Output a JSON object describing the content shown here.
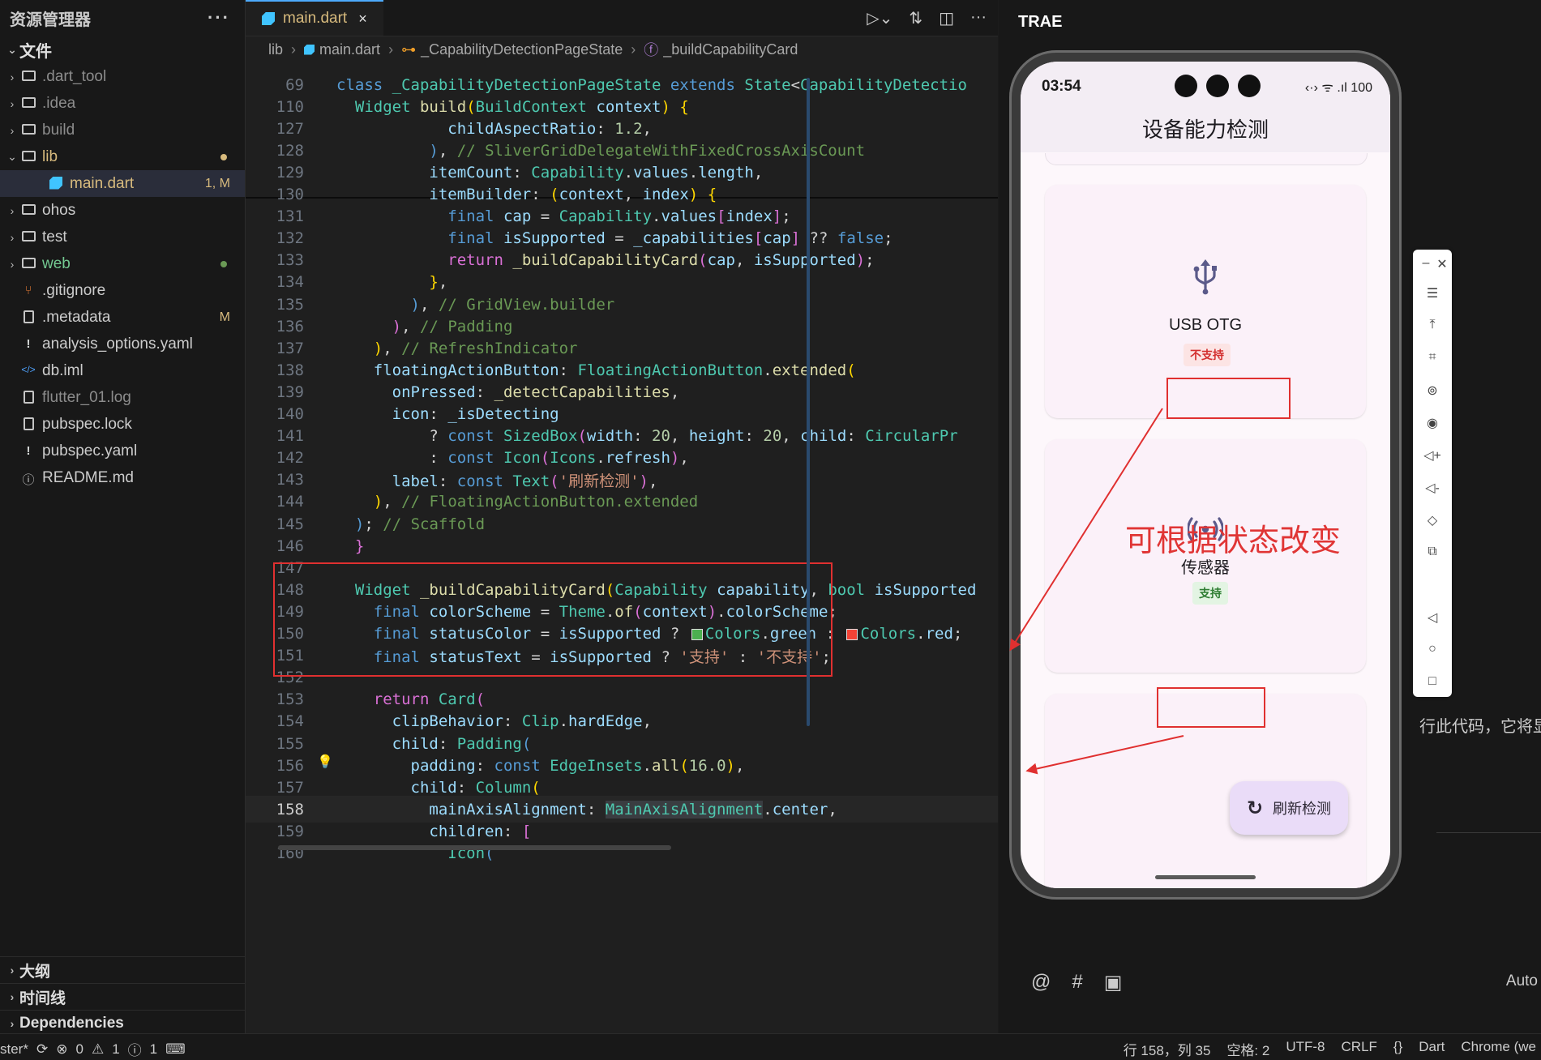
{
  "explorer": {
    "title": "资源管理器",
    "more": "···",
    "section": "文件",
    "items": [
      {
        "name": ".dart_tool",
        "kind": "folder"
      },
      {
        "name": ".idea",
        "kind": "folder"
      },
      {
        "name": "build",
        "kind": "folder"
      },
      {
        "name": "lib",
        "kind": "folder-open",
        "dot": "#d7ba7d"
      },
      {
        "name": "main.dart",
        "kind": "dart",
        "badge": "1, M",
        "selected": true
      },
      {
        "name": "ohos",
        "kind": "folder"
      },
      {
        "name": "test",
        "kind": "folder"
      },
      {
        "name": "web",
        "kind": "folder",
        "dot": "#6a9955"
      },
      {
        "name": ".gitignore",
        "kind": "git"
      },
      {
        "name": ".metadata",
        "kind": "file",
        "badge": "M"
      },
      {
        "name": "analysis_options.yaml",
        "kind": "yaml"
      },
      {
        "name": "db.iml",
        "kind": "code"
      },
      {
        "name": "flutter_01.log",
        "kind": "file"
      },
      {
        "name": "pubspec.lock",
        "kind": "file"
      },
      {
        "name": "pubspec.yaml",
        "kind": "yaml"
      },
      {
        "name": "README.md",
        "kind": "info"
      }
    ],
    "bottom": [
      "大纲",
      "时间线",
      "Dependencies"
    ]
  },
  "editor": {
    "tab": {
      "label": "main.dart",
      "close": "×"
    },
    "breadcrumb": [
      "lib",
      "main.dart",
      "_CapabilityDetectionPageState",
      "_buildCapabilityCard"
    ],
    "lines": [
      {
        "n": "69",
        "html": "<span class='k'>class</span> <span class='t'>_CapabilityDetectionPageState</span> <span class='k'>extends</span> <span class='t'>State</span><span class='o'>&lt;</span><span class='t'>CapabilityDetectio</span>"
      },
      {
        "n": "110",
        "html": "  <span class='t'>Widget</span> <span class='f'>build</span><span class='y'>(</span><span class='t'>BuildContext</span> <span class='v'>context</span><span class='y'>)</span> <span class='y'>{</span>"
      },
      {
        "n": "127",
        "html": "            <span class='v'>childAspectRatio</span><span class='o'>:</span> <span class='n'>1.2</span><span class='o'>,</span>"
      },
      {
        "n": "128",
        "html": "          <span class='k'>)</span><span class='o'>,</span> <span class='c'>// SliverGridDelegateWithFixedCrossAxisCount</span>"
      },
      {
        "n": "129",
        "html": "          <span class='v'>itemCount</span><span class='o'>:</span> <span class='t'>Capability</span><span class='o'>.</span><span class='v'>values</span><span class='o'>.</span><span class='v'>length</span><span class='o'>,</span>"
      },
      {
        "n": "130",
        "html": "          <span class='v'>itemBuilder</span><span class='o'>:</span> <span class='y'>(</span><span class='v'>context</span><span class='o'>,</span> <span class='v'>index</span><span class='y'>)</span> <span class='y'>{</span>"
      },
      {
        "n": "131",
        "html": "            <span class='k'>final</span> <span class='v'>cap</span> <span class='o'>=</span> <span class='t'>Capability</span><span class='o'>.</span><span class='v'>values</span><span class='m'>[</span><span class='v'>index</span><span class='m'>]</span><span class='o'>;</span>"
      },
      {
        "n": "132",
        "html": "            <span class='k'>final</span> <span class='v'>isSupported</span> <span class='o'>=</span> <span class='v'>_capabilities</span><span class='m'>[</span><span class='v'>cap</span><span class='m'>]</span> <span class='o'>??</span> <span class='k'>false</span><span class='o'>;</span>"
      },
      {
        "n": "133",
        "html": "            <span class='m'>return</span> <span class='f'>_buildCapabilityCard</span><span class='m'>(</span><span class='v'>cap</span><span class='o'>,</span> <span class='v'>isSupported</span><span class='m'>)</span><span class='o'>;</span>"
      },
      {
        "n": "134",
        "html": "          <span class='y'>}</span><span class='o'>,</span>"
      },
      {
        "n": "135",
        "html": "        <span class='k'>)</span><span class='o'>,</span> <span class='c'>// GridView.builder</span>"
      },
      {
        "n": "136",
        "html": "      <span class='m'>)</span><span class='o'>,</span> <span class='c'>// Padding</span>"
      },
      {
        "n": "137",
        "html": "    <span class='y'>)</span><span class='o'>,</span> <span class='c'>// RefreshIndicator</span>"
      },
      {
        "n": "138",
        "html": "    <span class='v'>floatingActionButton</span><span class='o'>:</span> <span class='t'>FloatingActionButton</span><span class='o'>.</span><span class='f'>extended</span><span class='y'>(</span>"
      },
      {
        "n": "139",
        "html": "      <span class='v'>onPressed</span><span class='o'>:</span> <span class='f'>_detectCapabilities</span><span class='o'>,</span>"
      },
      {
        "n": "140",
        "html": "      <span class='v'>icon</span><span class='o'>:</span> <span class='v'>_isDetecting</span>"
      },
      {
        "n": "141",
        "html": "          <span class='o'>?</span> <span class='k'>const</span> <span class='t'>SizedBox</span><span class='m'>(</span><span class='v'>width</span><span class='o'>:</span> <span class='n'>20</span><span class='o'>,</span> <span class='v'>height</span><span class='o'>:</span> <span class='n'>20</span><span class='o'>,</span> <span class='v'>child</span><span class='o'>:</span> <span class='t'>CircularPr</span>"
      },
      {
        "n": "142",
        "html": "          <span class='o'>:</span> <span class='k'>const</span> <span class='t'>Icon</span><span class='m'>(</span><span class='t'>Icons</span><span class='o'>.</span><span class='v'>refresh</span><span class='m'>)</span><span class='o'>,</span>"
      },
      {
        "n": "143",
        "html": "      <span class='v'>label</span><span class='o'>:</span> <span class='k'>const</span> <span class='t'>Text</span><span class='m'>(</span><span class='s'>'刷新检测'</span><span class='m'>)</span><span class='o'>,</span>"
      },
      {
        "n": "144",
        "html": "    <span class='y'>)</span><span class='o'>,</span> <span class='c'>// FloatingActionButton.extended</span>"
      },
      {
        "n": "145",
        "html": "  <span class='k'>)</span><span class='o'>;</span> <span class='c'>// Scaffold</span>"
      },
      {
        "n": "146",
        "html": "  <span class='m'>}</span>"
      },
      {
        "n": "147",
        "html": ""
      },
      {
        "n": "148",
        "html": "  <span class='t'>Widget</span> <span class='f'>_buildCapabilityCard</span><span class='y'>(</span><span class='t'>Capability</span> <span class='v'>capability</span><span class='o'>,</span> <span class='t'>bool</span> <span class='v'>isSupported</span>"
      },
      {
        "n": "149",
        "html": "    <span class='k'>final</span> <span class='v'>colorScheme</span> <span class='o'>=</span> <span class='t'>Theme</span><span class='o'>.</span><span class='f'>of</span><span class='m'>(</span><span class='v'>context</span><span class='m'>)</span><span class='o'>.</span><span class='v'>colorScheme</span><span class='o'>;</span>"
      },
      {
        "n": "150",
        "html": "    <span class='k'>final</span> <span class='v'>statusColor</span> <span class='o'>=</span> <span class='v'>isSupported</span> <span class='o'>?</span> <span class='swatch' style='background:#4caf50'></span><span class='t'>Colors</span><span class='o'>.</span><span class='v'>green</span> <span class='o'>:</span> <span class='swatch' style='background:#f44336'></span><span class='t'>Colors</span><span class='o'>.</span><span class='v'>red</span><span class='o'>;</span>"
      },
      {
        "n": "151",
        "html": "    <span class='k'>final</span> <span class='v'>statusText</span> <span class='o'>=</span> <span class='v'>isSupported</span> <span class='o'>?</span> <span class='s'>'支持'</span> <span class='o'>:</span> <span class='s'>'不支持'</span><span class='o'>;</span>"
      },
      {
        "n": "152",
        "html": ""
      },
      {
        "n": "153",
        "html": "    <span class='m'>return</span> <span class='t'>Card</span><span class='m'>(</span>"
      },
      {
        "n": "154",
        "html": "      <span class='v'>clipBehavior</span><span class='o'>:</span> <span class='t'>Clip</span><span class='o'>.</span><span class='v'>hardEdge</span><span class='o'>,</span>"
      },
      {
        "n": "155",
        "html": "      <span class='v'>child</span><span class='o'>:</span> <span class='t'>Padding</span><span class='k'>(</span>"
      },
      {
        "n": "156",
        "html": "        <span class='v'>padding</span><span class='o'>:</span> <span class='k'>const</span> <span class='t'>EdgeInsets</span><span class='o'>.</span><span class='f'>all</span><span class='y'>(</span><span class='n'>16.0</span><span class='y'>)</span><span class='o'>,</span>"
      },
      {
        "n": "157",
        "html": "        <span class='v'>child</span><span class='o'>:</span> <span class='t'>Column</span><span class='y'>(</span>"
      },
      {
        "n": "158",
        "html": "          <span class='v'>mainAxisAlignment</span><span class='o'>:</span> <span class='t' style='background:#3a3d41'>MainAxisAlignment</span><span class='o'>.</span><span class='v'>center</span><span class='o'>,</span>",
        "current": true
      },
      {
        "n": "159",
        "html": "          <span class='v'>children</span><span class='o'>:</span> <span class='m'>[</span>"
      },
      {
        "n": "160",
        "html": "            <span class='t'>Icon</span><span class='k'>(</span>"
      }
    ]
  },
  "right": {
    "title": "TRAE",
    "partial_text": "行此代码，它将显",
    "auto_label": "Auto"
  },
  "phone": {
    "time": "03:54",
    "status_icons": "‹·›  ᯤ  .ıl  100",
    "app_title": "设备能力检测",
    "cards": [
      {
        "label": "USB OTG",
        "status": "不支持",
        "supported": false
      },
      {
        "label": "传感器",
        "status": "支持",
        "supported": true
      }
    ],
    "fab_label": "刷新检测"
  },
  "annotation": "可根据状态改变",
  "statusbar": {
    "branch": "ster*",
    "errors": "0",
    "warnings": "1",
    "infos": "1",
    "position": "行 158，列 35",
    "indent": "空格: 2",
    "encoding": "UTF-8",
    "eol": "CRLF",
    "braces": "{}",
    "language": "Dart",
    "device": "Chrome (we"
  },
  "colors": {
    "accent": "#4daafc",
    "red": "#e03030",
    "supported": "#2e7d32",
    "unsupported": "#d32f2f"
  }
}
